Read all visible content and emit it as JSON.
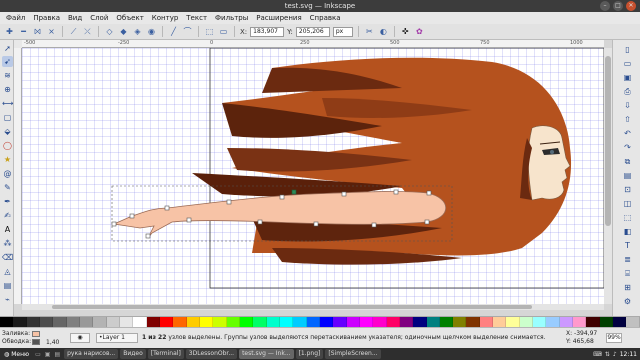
{
  "window": {
    "title": "test.svg — Inkscape"
  },
  "menu": [
    "Файл",
    "Правка",
    "Вид",
    "Слой",
    "Объект",
    "Контур",
    "Текст",
    "Фильтры",
    "Расширения",
    "Справка"
  ],
  "toolbar": {
    "x_label": "X:",
    "x_value": "183,907",
    "y_label": "Y:",
    "y_value": "205,206",
    "unit": "px"
  },
  "ruler_h": [
    "-500",
    "-250",
    "0",
    "250",
    "500",
    "750",
    "1000"
  ],
  "status": {
    "fill_label": "Заливка:",
    "stroke_label": "Обводка:",
    "stroke_width": "1,40",
    "layer": "•Layer 1",
    "message_bold": "1 из 22",
    "message": " узлов выделены. Группы узлов выделяются перетаскиванием указателя; одиночным щелчком выделение снимается.",
    "coord_x": "X: -394,97",
    "coord_y": "Y: 465,68",
    "zoom": "99%"
  },
  "palette": [
    "#000000",
    "#1a1a1a",
    "#333333",
    "#4d4d4d",
    "#666666",
    "#808080",
    "#999999",
    "#b3b3b3",
    "#cccccc",
    "#e6e6e6",
    "#ffffff",
    "#800000",
    "#ff0000",
    "#ff6600",
    "#ffcc00",
    "#ffff00",
    "#ccff00",
    "#66ff00",
    "#00ff00",
    "#00ff66",
    "#00ffcc",
    "#00ffff",
    "#00ccff",
    "#0066ff",
    "#0000ff",
    "#6600ff",
    "#cc00ff",
    "#ff00ff",
    "#ff00cc",
    "#ff0066",
    "#800080",
    "#000080",
    "#008080",
    "#008000",
    "#808000",
    "#803300",
    "#ff8080",
    "#ffcc99",
    "#ffff99",
    "#ccffcc",
    "#99ffff",
    "#99ccff",
    "#cc99ff",
    "#ff99cc",
    "#400000",
    "#004000",
    "#000040",
    "#c0c0c0"
  ],
  "taskbar": {
    "start": "Меню",
    "tasks": [
      "рука нарисов...",
      "Видео",
      "[Terminal]",
      "3DLessonObr...",
      "test.svg — Ink...",
      "[1.png]",
      "[SimpleScreen..."
    ],
    "clock": "12:11"
  }
}
